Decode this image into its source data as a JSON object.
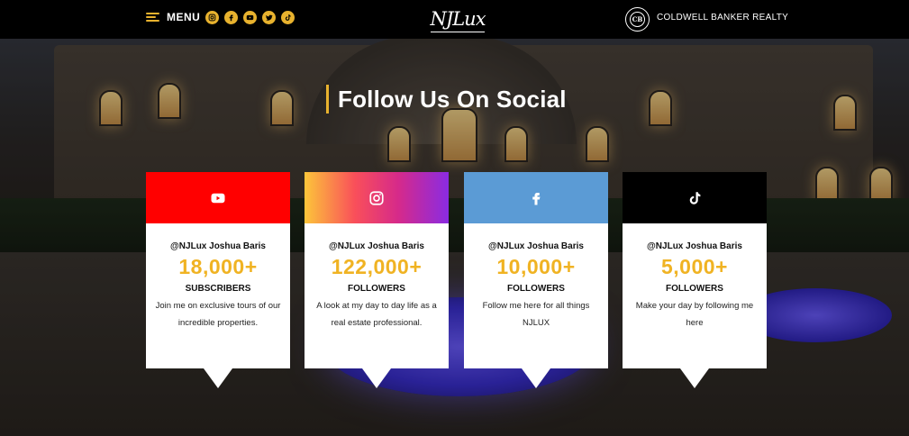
{
  "header": {
    "menu_label": "MENU",
    "social_icons": [
      "instagram-icon",
      "facebook-icon",
      "youtube-icon",
      "twitter-icon",
      "tiktok-icon"
    ],
    "logo_text": "NJLux",
    "partner_monogram": "CB",
    "partner_text": "COLDWELL BANKER REALTY"
  },
  "section": {
    "title": "Follow Us On Social"
  },
  "cards": [
    {
      "platform_icon": "youtube-icon",
      "color": "#ff0000",
      "handle": "@NJLux Joshua Baris",
      "count": "18,000+",
      "kind": "SUBSCRIBERS",
      "description": "Join me on exclusive tours of our incredible properties."
    },
    {
      "platform_icon": "instagram-icon",
      "color": "#d62a8a",
      "handle": "@NJLux Joshua Baris",
      "count": "122,000+",
      "kind": "FOLLOWERS",
      "description": "A look at my day to day life as a real estate professional."
    },
    {
      "platform_icon": "facebook-icon",
      "color": "#5b9bd5",
      "handle": "@NJLux Joshua Baris",
      "count": "10,000+",
      "kind": "FOLLOWERS",
      "description": "Follow me here for all things NJLUX"
    },
    {
      "platform_icon": "tiktok-icon",
      "color": "#000000",
      "handle": "@NJLux Joshua Baris",
      "count": "5,000+",
      "kind": "FOLLOWERS",
      "description": "Make your day by following me here"
    }
  ],
  "colors": {
    "accent": "#e8b22e",
    "count": "#f0b323",
    "header_bg": "#000000"
  }
}
